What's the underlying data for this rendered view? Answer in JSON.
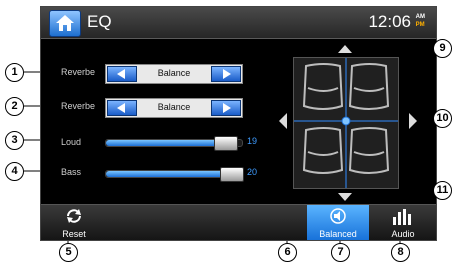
{
  "header": {
    "title": "EQ",
    "time": "12:06",
    "am": "AM",
    "pm": "PM"
  },
  "rows": [
    {
      "label": "Reverbe",
      "value": "Balance"
    },
    {
      "label": "Reverbe",
      "value": "Balance"
    }
  ],
  "sliders": [
    {
      "label": "Loud",
      "value": "19",
      "level": 0.95
    },
    {
      "label": "Bass",
      "value": "20",
      "level": 1.0
    }
  ],
  "bottom": {
    "reset": "Reset",
    "balanced": "Balanced",
    "audio": "Audio"
  },
  "callouts": [
    "1",
    "2",
    "3",
    "4",
    "5",
    "6",
    "7",
    "8",
    "9",
    "10",
    "11"
  ],
  "colors": {
    "accent": "#1c6fd6",
    "value_text": "#3f9cff"
  }
}
